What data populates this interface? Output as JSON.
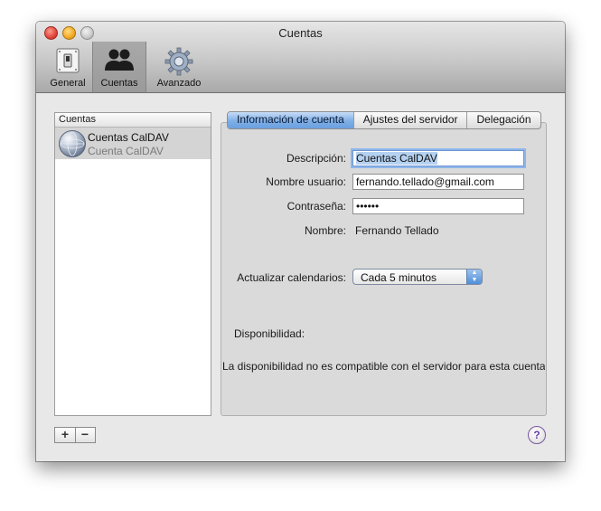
{
  "window": {
    "title": "Cuentas"
  },
  "toolbar": {
    "items": [
      {
        "label": "General",
        "icon": "switch-icon",
        "selected": false
      },
      {
        "label": "Cuentas",
        "icon": "users-icon",
        "selected": true
      },
      {
        "label": "Avanzado",
        "icon": "gear-icon",
        "selected": false
      }
    ]
  },
  "accounts_list": {
    "header": "Cuentas",
    "items": [
      {
        "name": "Cuentas CalDAV",
        "subtitle": "Cuenta CalDAV",
        "icon": "globe-icon"
      }
    ],
    "add_label": "+",
    "remove_label": "−"
  },
  "tabs": [
    {
      "label": "Información de cuenta",
      "active": true
    },
    {
      "label": "Ajustes del servidor",
      "active": false
    },
    {
      "label": "Delegación",
      "active": false
    }
  ],
  "form": {
    "description_label": "Descripción:",
    "description_value": "Cuentas CalDAV",
    "username_label": "Nombre usuario:",
    "username_value": "fernando.tellado@gmail.com",
    "password_label": "Contraseña:",
    "password_value": "••••••",
    "name_label": "Nombre:",
    "name_value": "Fernando Tellado",
    "refresh_label": "Actualizar calendarios:",
    "refresh_value": "Cada 5 minutos"
  },
  "availability": {
    "label": "Disponibilidad:",
    "message": "La disponibilidad no es compatible con el servidor para esta cuenta."
  },
  "help": {
    "label": "?"
  },
  "colors": {
    "accent": "#6aa0e0",
    "selection": "#b5d1f1",
    "help": "#6a3ea6"
  }
}
